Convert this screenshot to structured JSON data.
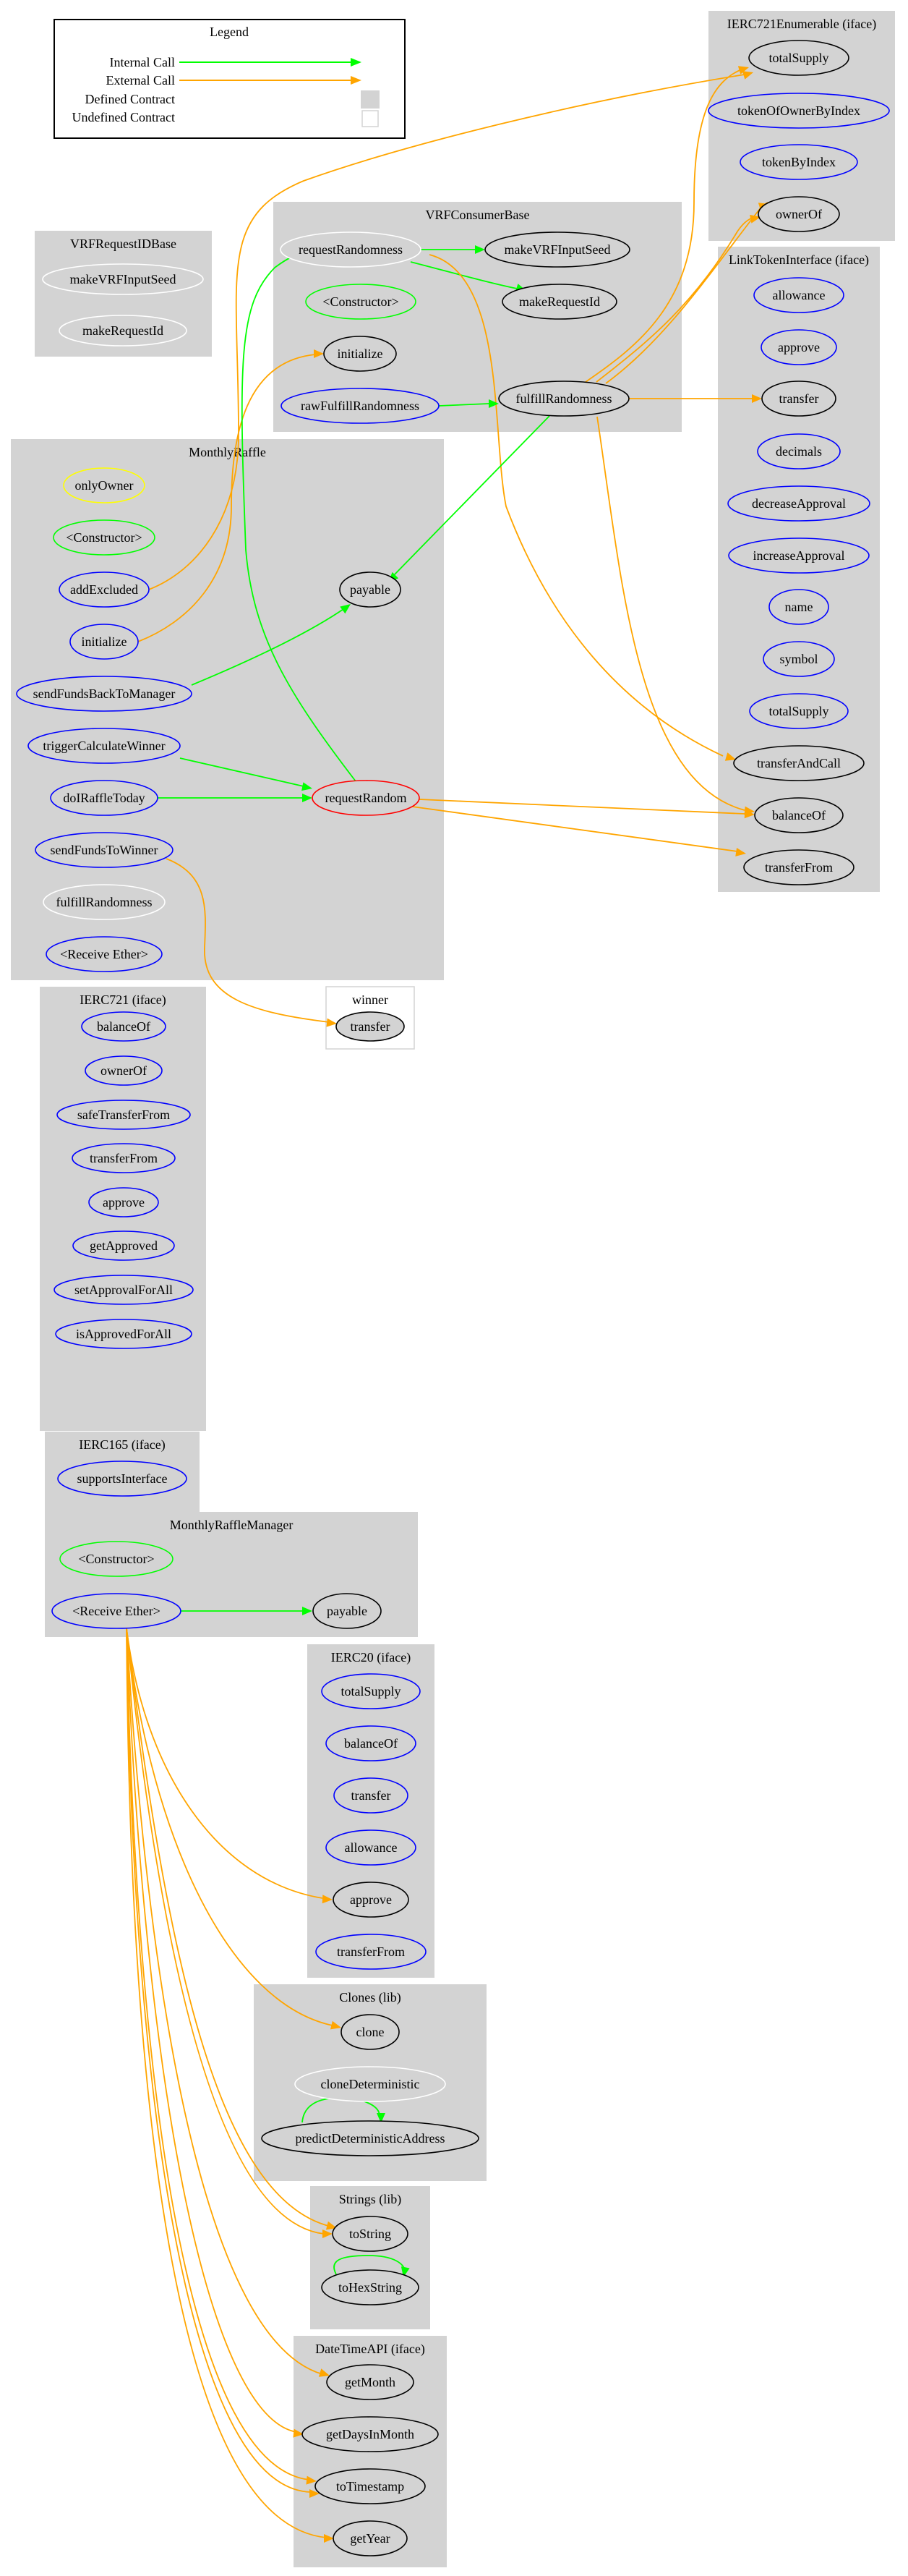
{
  "legend": {
    "title": "Legend",
    "items": [
      {
        "label": "Internal Call",
        "kind": "internal"
      },
      {
        "label": "External Call",
        "kind": "external"
      },
      {
        "label": "Defined Contract",
        "kind": "defined"
      },
      {
        "label": "Undefined Contract",
        "kind": "undefined"
      }
    ]
  },
  "colors": {
    "internal_call": "#00ff00",
    "external_call": "#ffa500",
    "defined_contract_fill": "#d3d3d3",
    "undefined_contract_border": "#d3d3d3",
    "public_function": "#0000ff",
    "internal_function": "#000000",
    "modifier": "#ffff00",
    "constructor": "#00ff00",
    "inherited_unused": "#ffffff",
    "payable_special": "#ff0000"
  },
  "clusters": [
    {
      "id": "IERC721Enumerable",
      "title": "IERC721Enumerable  (iface)",
      "defined": true,
      "nodes": [
        {
          "id": "e_totalSupply",
          "label": "totalSupply",
          "stroke": "black"
        },
        {
          "id": "e_tokenOfOwnerByIndex",
          "label": "tokenOfOwnerByIndex",
          "stroke": "blue"
        },
        {
          "id": "e_tokenByIndex",
          "label": "tokenByIndex",
          "stroke": "blue"
        },
        {
          "id": "e_ownerOf",
          "label": "ownerOf",
          "stroke": "black"
        }
      ]
    },
    {
      "id": "VRFRequestIDBase",
      "title": "VRFRequestIDBase",
      "defined": true,
      "nodes": [
        {
          "id": "r_makeVRFInputSeed",
          "label": "makeVRFInputSeed",
          "stroke": "white"
        },
        {
          "id": "r_makeRequestId",
          "label": "makeRequestId",
          "stroke": "white"
        }
      ]
    },
    {
      "id": "VRFConsumerBase",
      "title": "VRFConsumerBase",
      "defined": true,
      "nodes": [
        {
          "id": "v_requestRandomness",
          "label": "requestRandomness",
          "stroke": "white"
        },
        {
          "id": "v_makeVRFInputSeed",
          "label": "makeVRFInputSeed",
          "stroke": "black"
        },
        {
          "id": "v_constructor",
          "label": "<Constructor>",
          "stroke": "green"
        },
        {
          "id": "v_makeRequestId",
          "label": "makeRequestId",
          "stroke": "black"
        },
        {
          "id": "v_initialize",
          "label": "initialize",
          "stroke": "black"
        },
        {
          "id": "v_rawFulfillRandomness",
          "label": "rawFulfillRandomness",
          "stroke": "blue"
        },
        {
          "id": "v_fulfillRandomness",
          "label": "fulfillRandomness",
          "stroke": "black"
        }
      ]
    },
    {
      "id": "LinkTokenInterface",
      "title": "LinkTokenInterface  (iface)",
      "defined": true,
      "nodes": [
        {
          "id": "l_allowance",
          "label": "allowance",
          "stroke": "blue"
        },
        {
          "id": "l_approve",
          "label": "approve",
          "stroke": "blue"
        },
        {
          "id": "l_transfer",
          "label": "transfer",
          "stroke": "black"
        },
        {
          "id": "l_decimals",
          "label": "decimals",
          "stroke": "blue"
        },
        {
          "id": "l_decreaseApproval",
          "label": "decreaseApproval",
          "stroke": "blue"
        },
        {
          "id": "l_increaseApproval",
          "label": "increaseApproval",
          "stroke": "blue"
        },
        {
          "id": "l_name",
          "label": "name",
          "stroke": "blue"
        },
        {
          "id": "l_symbol",
          "label": "symbol",
          "stroke": "blue"
        },
        {
          "id": "l_totalSupply",
          "label": "totalSupply",
          "stroke": "blue"
        },
        {
          "id": "l_transferAndCall",
          "label": "transferAndCall",
          "stroke": "black"
        },
        {
          "id": "l_balanceOf",
          "label": "balanceOf",
          "stroke": "black"
        },
        {
          "id": "l_transferFrom",
          "label": "transferFrom",
          "stroke": "black"
        }
      ]
    },
    {
      "id": "MonthlyRaffle",
      "title": "MonthlyRaffle",
      "defined": true,
      "nodes": [
        {
          "id": "m_onlyOwner",
          "label": "onlyOwner",
          "stroke": "yellow"
        },
        {
          "id": "m_constructor",
          "label": "<Constructor>",
          "stroke": "green"
        },
        {
          "id": "m_addExcluded",
          "label": "addExcluded",
          "stroke": "blue"
        },
        {
          "id": "m_payable",
          "label": "payable",
          "stroke": "black"
        },
        {
          "id": "m_initialize",
          "label": "initialize",
          "stroke": "blue"
        },
        {
          "id": "m_sendFundsBackToManager",
          "label": "sendFundsBackToManager",
          "stroke": "blue"
        },
        {
          "id": "m_triggerCalculateWinner",
          "label": "triggerCalculateWinner",
          "stroke": "blue"
        },
        {
          "id": "m_doIRaffleToday",
          "label": "doIRaffleToday",
          "stroke": "blue"
        },
        {
          "id": "m_requestRandom",
          "label": "requestRandom",
          "stroke": "red"
        },
        {
          "id": "m_sendFundsToWinner",
          "label": "sendFundsToWinner",
          "stroke": "blue"
        },
        {
          "id": "m_fulfillRandomness",
          "label": "fulfillRandomness",
          "stroke": "white"
        },
        {
          "id": "m_receiveEther",
          "label": "<Receive Ether>",
          "stroke": "blue"
        }
      ]
    },
    {
      "id": "winner",
      "title": "winner",
      "defined": false,
      "nodes": [
        {
          "id": "w_transfer",
          "label": "transfer",
          "stroke": "black"
        }
      ]
    },
    {
      "id": "IERC721",
      "title": "IERC721  (iface)",
      "defined": true,
      "nodes": [
        {
          "id": "i_balanceOf",
          "label": "balanceOf",
          "stroke": "blue"
        },
        {
          "id": "i_ownerOf",
          "label": "ownerOf",
          "stroke": "blue"
        },
        {
          "id": "i_safeTransferFrom",
          "label": "safeTransferFrom",
          "stroke": "blue"
        },
        {
          "id": "i_transferFrom",
          "label": "transferFrom",
          "stroke": "blue"
        },
        {
          "id": "i_approve",
          "label": "approve",
          "stroke": "blue"
        },
        {
          "id": "i_getApproved",
          "label": "getApproved",
          "stroke": "blue"
        },
        {
          "id": "i_setApprovalForAll",
          "label": "setApprovalForAll",
          "stroke": "blue"
        },
        {
          "id": "i_isApprovedForAll",
          "label": "isApprovedForAll",
          "stroke": "blue"
        }
      ]
    },
    {
      "id": "IERC165",
      "title": "IERC165  (iface)",
      "defined": true,
      "nodes": [
        {
          "id": "s_supportsInterface",
          "label": "supportsInterface",
          "stroke": "blue"
        }
      ]
    },
    {
      "id": "MonthlyRaffleManager",
      "title": "MonthlyRaffleManager",
      "defined": true,
      "nodes": [
        {
          "id": "g_constructor",
          "label": "<Constructor>",
          "stroke": "green"
        },
        {
          "id": "g_receiveEther",
          "label": "<Receive Ether>",
          "stroke": "blue"
        },
        {
          "id": "g_payable",
          "label": "payable",
          "stroke": "black"
        }
      ]
    },
    {
      "id": "IERC20",
      "title": "IERC20  (iface)",
      "defined": true,
      "nodes": [
        {
          "id": "t_totalSupply",
          "label": "totalSupply",
          "stroke": "blue"
        },
        {
          "id": "t_balanceOf",
          "label": "balanceOf",
          "stroke": "blue"
        },
        {
          "id": "t_transfer",
          "label": "transfer",
          "stroke": "blue"
        },
        {
          "id": "t_allowance",
          "label": "allowance",
          "stroke": "blue"
        },
        {
          "id": "t_approve",
          "label": "approve",
          "stroke": "black"
        },
        {
          "id": "t_transferFrom",
          "label": "transferFrom",
          "stroke": "blue"
        }
      ]
    },
    {
      "id": "Clones",
      "title": "Clones  (lib)",
      "defined": true,
      "nodes": [
        {
          "id": "c_clone",
          "label": "clone",
          "stroke": "black"
        },
        {
          "id": "c_cloneDeterministic",
          "label": "cloneDeterministic",
          "stroke": "white"
        },
        {
          "id": "c_predictDeterministicAddress",
          "label": "predictDeterministicAddress",
          "stroke": "black"
        }
      ]
    },
    {
      "id": "Strings",
      "title": "Strings  (lib)",
      "defined": true,
      "nodes": [
        {
          "id": "st_toString",
          "label": "toString",
          "stroke": "black"
        },
        {
          "id": "st_toHexString",
          "label": "toHexString",
          "stroke": "black"
        }
      ]
    },
    {
      "id": "DateTimeAPI",
      "title": "DateTimeAPI  (iface)",
      "defined": true,
      "nodes": [
        {
          "id": "d_getMonth",
          "label": "getMonth",
          "stroke": "black"
        },
        {
          "id": "d_getDaysInMonth",
          "label": "getDaysInMonth",
          "stroke": "black"
        },
        {
          "id": "d_toTimestamp",
          "label": "toTimestamp",
          "stroke": "black"
        },
        {
          "id": "d_getYear",
          "label": "getYear",
          "stroke": "black"
        }
      ]
    }
  ],
  "edges": [
    {
      "from": "v_requestRandomness",
      "to": "v_makeVRFInputSeed",
      "kind": "internal"
    },
    {
      "from": "v_requestRandomness",
      "to": "v_makeRequestId",
      "kind": "internal"
    },
    {
      "from": "v_requestRandomness",
      "to": "l_transferAndCall",
      "kind": "external"
    },
    {
      "from": "v_rawFulfillRandomness",
      "to": "v_fulfillRandomness",
      "kind": "internal"
    },
    {
      "from": "v_fulfillRandomness",
      "to": "m_payable",
      "kind": "internal"
    },
    {
      "from": "v_fulfillRandomness",
      "to": "l_transfer",
      "kind": "external"
    },
    {
      "from": "v_fulfillRandomness",
      "to": "l_balanceOf",
      "kind": "external"
    },
    {
      "from": "v_fulfillRandomness",
      "to": "e_totalSupply",
      "kind": "external"
    },
    {
      "from": "v_fulfillRandomness",
      "to": "e_ownerOf",
      "kind": "external"
    },
    {
      "from": "v_fulfillRandomness",
      "to": "e_ownerOf",
      "kind": "external"
    },
    {
      "from": "m_addExcluded",
      "to": "e_totalSupply",
      "kind": "external"
    },
    {
      "from": "m_initialize",
      "to": "v_initialize",
      "kind": "external"
    },
    {
      "from": "m_sendFundsBackToManager",
      "to": "m_payable",
      "kind": "internal"
    },
    {
      "from": "m_triggerCalculateWinner",
      "to": "m_requestRandom",
      "kind": "internal"
    },
    {
      "from": "m_doIRaffleToday",
      "to": "m_requestRandom",
      "kind": "internal"
    },
    {
      "from": "m_requestRandom",
      "to": "v_requestRandomness",
      "kind": "internal"
    },
    {
      "from": "m_requestRandom",
      "to": "l_balanceOf",
      "kind": "external"
    },
    {
      "from": "m_requestRandom",
      "to": "l_transferFrom",
      "kind": "external"
    },
    {
      "from": "m_sendFundsToWinner",
      "to": "w_transfer",
      "kind": "external"
    },
    {
      "from": "g_receiveEther",
      "to": "g_payable",
      "kind": "internal"
    },
    {
      "from": "g_receiveEther",
      "to": "t_approve",
      "kind": "external"
    },
    {
      "from": "g_receiveEther",
      "to": "c_clone",
      "kind": "external"
    },
    {
      "from": "g_receiveEther",
      "to": "st_toString",
      "kind": "external"
    },
    {
      "from": "g_receiveEther",
      "to": "st_toString",
      "kind": "external"
    },
    {
      "from": "g_receiveEther",
      "to": "d_getMonth",
      "kind": "external"
    },
    {
      "from": "g_receiveEther",
      "to": "d_getDaysInMonth",
      "kind": "external"
    },
    {
      "from": "g_receiveEther",
      "to": "d_toTimestamp",
      "kind": "external"
    },
    {
      "from": "g_receiveEther",
      "to": "d_toTimestamp",
      "kind": "external"
    },
    {
      "from": "g_receiveEther",
      "to": "d_getYear",
      "kind": "external"
    },
    {
      "from": "c_predictDeterministicAddress",
      "to": "c_predictDeterministicAddress",
      "kind": "internal"
    },
    {
      "from": "st_toHexString",
      "to": "st_toHexString",
      "kind": "internal"
    }
  ]
}
